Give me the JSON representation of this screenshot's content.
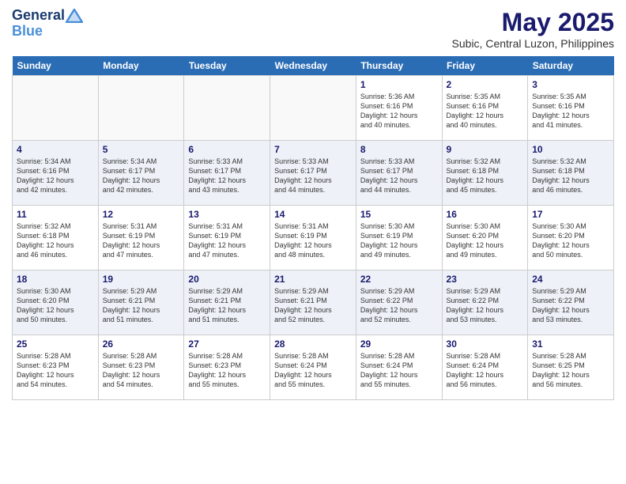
{
  "header": {
    "logo_line1": "General",
    "logo_line2": "Blue",
    "month_title": "May 2025",
    "subtitle": "Subic, Central Luzon, Philippines"
  },
  "days_of_week": [
    "Sunday",
    "Monday",
    "Tuesday",
    "Wednesday",
    "Thursday",
    "Friday",
    "Saturday"
  ],
  "weeks": [
    {
      "alt": false,
      "days": [
        {
          "num": "",
          "info": ""
        },
        {
          "num": "",
          "info": ""
        },
        {
          "num": "",
          "info": ""
        },
        {
          "num": "",
          "info": ""
        },
        {
          "num": "1",
          "info": "Sunrise: 5:36 AM\nSunset: 6:16 PM\nDaylight: 12 hours\nand 40 minutes."
        },
        {
          "num": "2",
          "info": "Sunrise: 5:35 AM\nSunset: 6:16 PM\nDaylight: 12 hours\nand 40 minutes."
        },
        {
          "num": "3",
          "info": "Sunrise: 5:35 AM\nSunset: 6:16 PM\nDaylight: 12 hours\nand 41 minutes."
        }
      ]
    },
    {
      "alt": true,
      "days": [
        {
          "num": "4",
          "info": "Sunrise: 5:34 AM\nSunset: 6:16 PM\nDaylight: 12 hours\nand 42 minutes."
        },
        {
          "num": "5",
          "info": "Sunrise: 5:34 AM\nSunset: 6:17 PM\nDaylight: 12 hours\nand 42 minutes."
        },
        {
          "num": "6",
          "info": "Sunrise: 5:33 AM\nSunset: 6:17 PM\nDaylight: 12 hours\nand 43 minutes."
        },
        {
          "num": "7",
          "info": "Sunrise: 5:33 AM\nSunset: 6:17 PM\nDaylight: 12 hours\nand 44 minutes."
        },
        {
          "num": "8",
          "info": "Sunrise: 5:33 AM\nSunset: 6:17 PM\nDaylight: 12 hours\nand 44 minutes."
        },
        {
          "num": "9",
          "info": "Sunrise: 5:32 AM\nSunset: 6:18 PM\nDaylight: 12 hours\nand 45 minutes."
        },
        {
          "num": "10",
          "info": "Sunrise: 5:32 AM\nSunset: 6:18 PM\nDaylight: 12 hours\nand 46 minutes."
        }
      ]
    },
    {
      "alt": false,
      "days": [
        {
          "num": "11",
          "info": "Sunrise: 5:32 AM\nSunset: 6:18 PM\nDaylight: 12 hours\nand 46 minutes."
        },
        {
          "num": "12",
          "info": "Sunrise: 5:31 AM\nSunset: 6:19 PM\nDaylight: 12 hours\nand 47 minutes."
        },
        {
          "num": "13",
          "info": "Sunrise: 5:31 AM\nSunset: 6:19 PM\nDaylight: 12 hours\nand 47 minutes."
        },
        {
          "num": "14",
          "info": "Sunrise: 5:31 AM\nSunset: 6:19 PM\nDaylight: 12 hours\nand 48 minutes."
        },
        {
          "num": "15",
          "info": "Sunrise: 5:30 AM\nSunset: 6:19 PM\nDaylight: 12 hours\nand 49 minutes."
        },
        {
          "num": "16",
          "info": "Sunrise: 5:30 AM\nSunset: 6:20 PM\nDaylight: 12 hours\nand 49 minutes."
        },
        {
          "num": "17",
          "info": "Sunrise: 5:30 AM\nSunset: 6:20 PM\nDaylight: 12 hours\nand 50 minutes."
        }
      ]
    },
    {
      "alt": true,
      "days": [
        {
          "num": "18",
          "info": "Sunrise: 5:30 AM\nSunset: 6:20 PM\nDaylight: 12 hours\nand 50 minutes."
        },
        {
          "num": "19",
          "info": "Sunrise: 5:29 AM\nSunset: 6:21 PM\nDaylight: 12 hours\nand 51 minutes."
        },
        {
          "num": "20",
          "info": "Sunrise: 5:29 AM\nSunset: 6:21 PM\nDaylight: 12 hours\nand 51 minutes."
        },
        {
          "num": "21",
          "info": "Sunrise: 5:29 AM\nSunset: 6:21 PM\nDaylight: 12 hours\nand 52 minutes."
        },
        {
          "num": "22",
          "info": "Sunrise: 5:29 AM\nSunset: 6:22 PM\nDaylight: 12 hours\nand 52 minutes."
        },
        {
          "num": "23",
          "info": "Sunrise: 5:29 AM\nSunset: 6:22 PM\nDaylight: 12 hours\nand 53 minutes."
        },
        {
          "num": "24",
          "info": "Sunrise: 5:29 AM\nSunset: 6:22 PM\nDaylight: 12 hours\nand 53 minutes."
        }
      ]
    },
    {
      "alt": false,
      "days": [
        {
          "num": "25",
          "info": "Sunrise: 5:28 AM\nSunset: 6:23 PM\nDaylight: 12 hours\nand 54 minutes."
        },
        {
          "num": "26",
          "info": "Sunrise: 5:28 AM\nSunset: 6:23 PM\nDaylight: 12 hours\nand 54 minutes."
        },
        {
          "num": "27",
          "info": "Sunrise: 5:28 AM\nSunset: 6:23 PM\nDaylight: 12 hours\nand 55 minutes."
        },
        {
          "num": "28",
          "info": "Sunrise: 5:28 AM\nSunset: 6:24 PM\nDaylight: 12 hours\nand 55 minutes."
        },
        {
          "num": "29",
          "info": "Sunrise: 5:28 AM\nSunset: 6:24 PM\nDaylight: 12 hours\nand 55 minutes."
        },
        {
          "num": "30",
          "info": "Sunrise: 5:28 AM\nSunset: 6:24 PM\nDaylight: 12 hours\nand 56 minutes."
        },
        {
          "num": "31",
          "info": "Sunrise: 5:28 AM\nSunset: 6:25 PM\nDaylight: 12 hours\nand 56 minutes."
        }
      ]
    }
  ]
}
